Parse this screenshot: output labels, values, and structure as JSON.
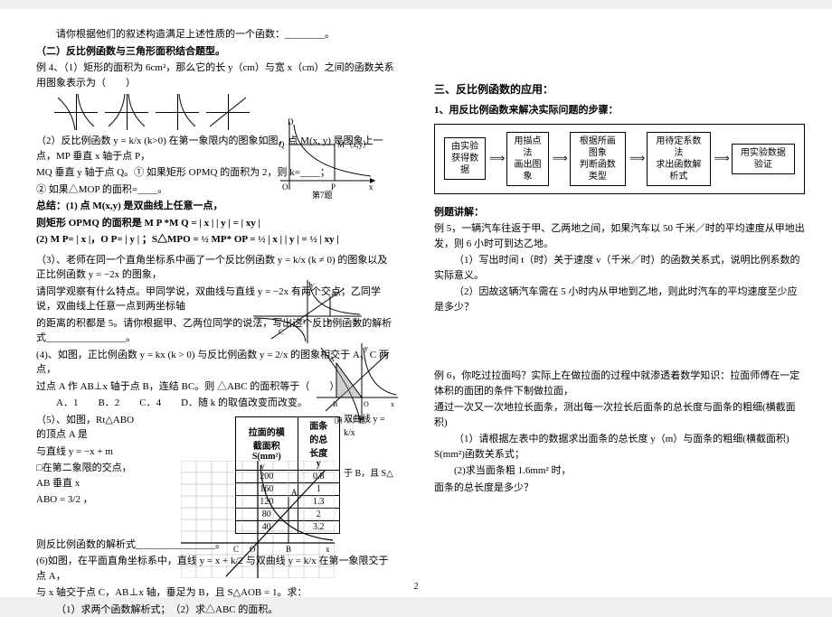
{
  "left": {
    "intro": "请你根据他们的叙述构造满足上述性质的一个函数：________。",
    "sub2": "（二）反比例函数与三角形面积结合题型。",
    "ex4_1": "例 4、（1）矩形的面积为 6cm²，那么它的长 y（cm）与宽 x（cm）之间的函数关系用图象表示为（　　）",
    "ex4_2a": "（2）反比例函数 y = k/x (k>0) 在第一象限内的图象如图，点 M(x, y) 是图象上一点，MP 垂直 x 轴于点 P，",
    "ex4_2b": "MQ 垂直 y 轴于点 Q。① 如果矩形 OPMQ 的面积为 2，则 k=____；",
    "ex4_2c": "② 如果△MOP 的面积=____。",
    "sum1a": "总结：(1) 点 M(x,y) 是双曲线上任意一点，",
    "sum1b": "则矩形 OPMQ 的面积是 M P *M Q = | x | | y | = | xy |",
    "sum2": "(2) M P= | x |，O P= | y | ；S△MPO = ½ MP* OP = ½ | x | | y | = ½ | xy |",
    "ex3a": "（3）、老师在同一个直角坐标系中画了一个反比例函数 y = k/x (k ≠ 0) 的图象以及正比例函数 y = −2x 的图象，",
    "ex3b": "请同学观察有什么特点。甲同学说，双曲线与直线 y = −2x 有两个交点；乙同学说，双曲线上任意一点到两坐标轴",
    "ex3c": "的距离的积都是 5。请你根据甲、乙两位同学的说法，写出这个反比例函数的解析式________________。",
    "ex4a": "(4)、如图，正比例函数 y = kx (k > 0) 与反比例函数 y = 2/x 的图象相交于 A、C 两点，",
    "ex4b": "过点 A 作 AB⊥x 轴于点 B，连结 BC。则 △ABC 的面积等于（　　）",
    "options": "A．1　　B．2　　C．4　　D．随 k 的取值改变而改变。",
    "ex5a": "（5）、如图，Rt△ABO 的顶点 A 是",
    "ex5b": "双曲线 y = k/x",
    "ex5c": "与直线 y = −x + m",
    "ex5d": "□在第二象限的交点，AB 垂直 x",
    "ex5e": "于 B，且 S△",
    "ex5f": "ABO = 3/2 ，",
    "ex5g": "则反比例函数的解析式________________。",
    "ex6a": "(6)如图，在平面直角坐标系中，直线 y = x + k/2 与双曲线 y = k/x 在第一象限交于点 A，",
    "ex6b": "与 x 轴交于点 C，AB⊥x 轴，垂足为 B，且 S△AOB = 1。求：",
    "ex6c": "（1）求两个函数解析式；　（2）求△ABC 的面积。",
    "table": {
      "h1": "拉面的横截面积 S(mm²)",
      "h2": "面条的总长度 y",
      "rows": [
        [
          "200",
          "0.8"
        ],
        [
          "160",
          "1"
        ],
        [
          "120",
          "1.3"
        ],
        [
          "80",
          "2"
        ],
        [
          "40",
          "3.2"
        ]
      ]
    },
    "fig7_labels": {
      "D": "D",
      "Q": "Q",
      "M": "M（x,y）",
      "O": "O",
      "P": "P",
      "x": "x",
      "cap": "第7题"
    },
    "fig4_labels": {
      "y": "y",
      "A": "A",
      "B": "B",
      "O": "O",
      "C": "C",
      "x": "x"
    },
    "fig5_labels": {
      "y": "y",
      "A": "A",
      "B": "B",
      "O": "O",
      "x": "x",
      "cap": "（第（5）题）"
    },
    "fig6_labels": {
      "y": "y",
      "A": "A",
      "C": "C",
      "O": "O",
      "B": "B",
      "x": "x"
    }
  },
  "right": {
    "h3": "三、反比例函数的应用：",
    "sub1": "1、用反比例函数来解决实际问题的步骤：",
    "flow": {
      "b1": "由实验\n获得数据",
      "b2": "用描点法\n画出图象",
      "b3": "根据所画图象\n判断函数类型",
      "b4": "用待定系数法\n求出函数解析式",
      "b5": "用实验数据验证"
    },
    "exh": "例题讲解：",
    "ex5a": "例 5，一辆汽车往返于甲、乙两地之间，如果汽车以 50 千米／时的平均速度从甲地出发，则 6 小时可到达乙地。",
    "ex5b": "（1）写出时间 t（时）关于速度 v（千米／时）的函数关系式，说明比例系数的实际意义。",
    "ex5c": "（2）因故这辆汽车需在 5 小时内从甲地到乙地，则此时汽车的平均速度至少应是多少？",
    "ex6a": "例 6，你吃过拉面吗？实际上在做拉面的过程中就渗透着数学知识：拉面师傅在一定体积的面团的条件下制做拉面，",
    "ex6b": "通过一次又一次地拉长面条，测出每一次拉长后面条的总长度与面条的粗细(横截面积)",
    "ex6c": "（1）请根据左表中的数据求出面条的总长度 y（m）与面条的粗细(横截面积) S(mm²)函数关系式；",
    "ex6d": "(2)求当面条粗 1.6mm² 时，",
    "ex6e": "面条的总长度是多少？"
  },
  "pageNum": "2"
}
